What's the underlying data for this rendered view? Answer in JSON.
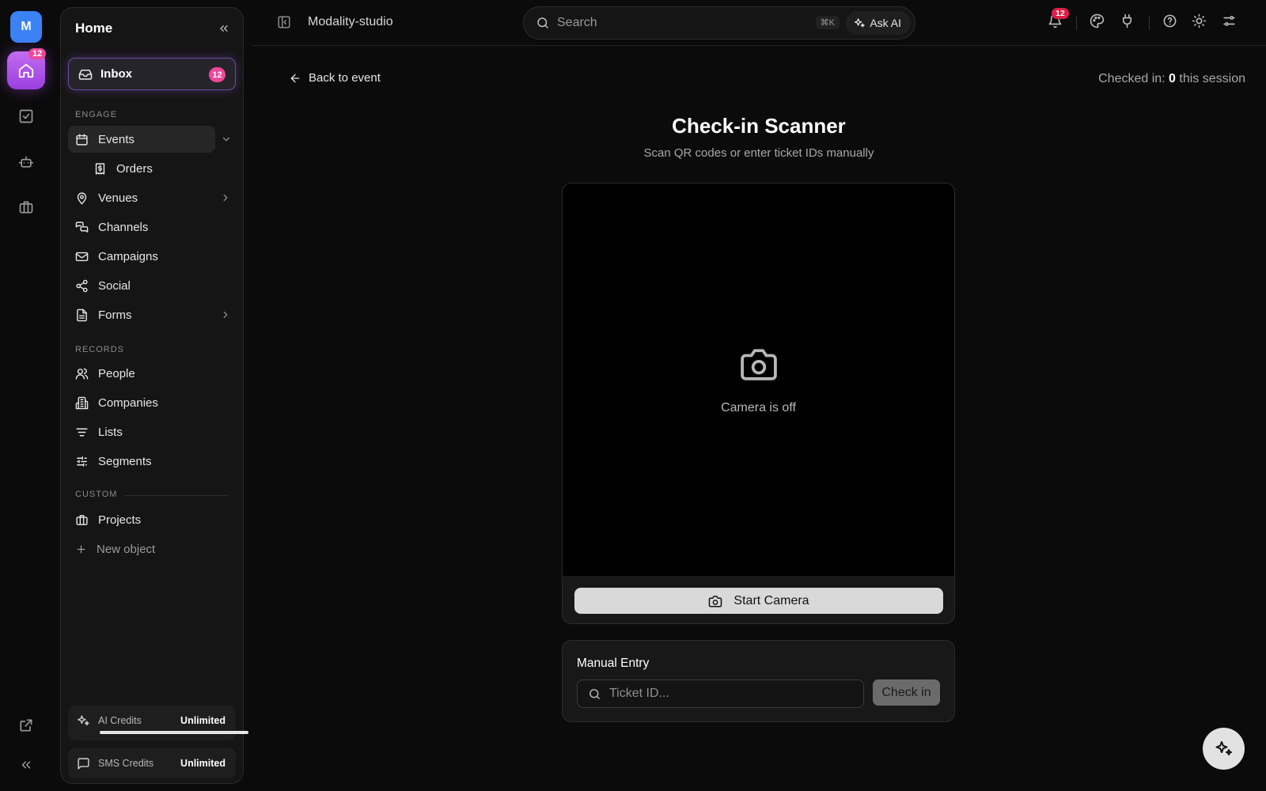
{
  "rail": {
    "workspace_initial": "M",
    "home_badge": "12"
  },
  "sidebar": {
    "title": "Home",
    "inbox": {
      "label": "Inbox",
      "badge": "12"
    },
    "sections": {
      "engage": "ENGAGE",
      "records": "RECORDS",
      "custom": "CUSTOM"
    },
    "items": {
      "events": "Events",
      "orders": "Orders",
      "venues": "Venues",
      "channels": "Channels",
      "campaigns": "Campaigns",
      "social": "Social",
      "forms": "Forms",
      "people": "People",
      "companies": "Companies",
      "lists": "Lists",
      "segments": "Segments",
      "projects": "Projects",
      "new_object": "New object"
    },
    "credits": [
      {
        "name": "AI Credits",
        "value": "Unlimited",
        "progress": 1.0
      },
      {
        "name": "SMS Credits",
        "value": "Unlimited"
      }
    ]
  },
  "topbar": {
    "workspace_name": "Modality-studio",
    "search": {
      "placeholder": "Search",
      "shortcut": "⌘K",
      "ask_ai": "Ask AI"
    },
    "notifications_badge": "12"
  },
  "main": {
    "back_label": "Back to event",
    "session": {
      "prefix": "Checked in: ",
      "count": "0",
      "suffix": " this session"
    },
    "title": "Check-in Scanner",
    "subtitle": "Scan QR codes or enter ticket IDs manually",
    "camera_status": "Camera is off",
    "start_camera": "Start Camera",
    "manual": {
      "heading": "Manual Entry",
      "placeholder": "Ticket ID...",
      "button": "Check in"
    }
  },
  "colors": {
    "accent": "#9b3fe0",
    "badge": "#ec4899",
    "workspace": "#3b82f6",
    "background": "#0b0b0b"
  }
}
